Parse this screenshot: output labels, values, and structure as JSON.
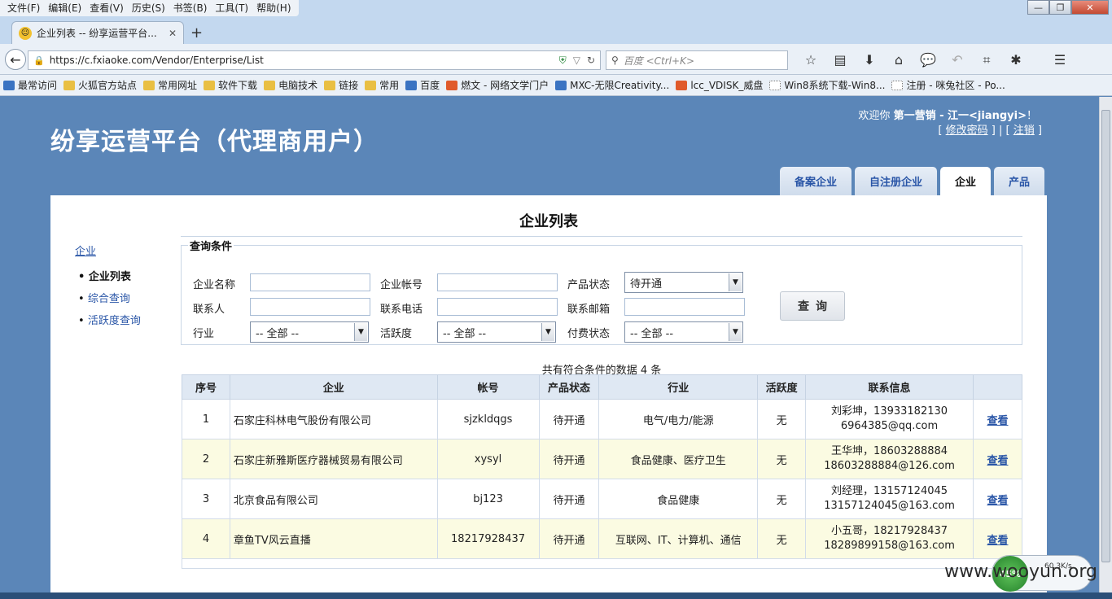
{
  "browser": {
    "menus": [
      "文件(F)",
      "编辑(E)",
      "查看(V)",
      "历史(S)",
      "书签(B)",
      "工具(T)",
      "帮助(H)"
    ],
    "tab_title": "企业列表 -- 纷享运营平台...",
    "url": "https://c.fxiaoke.com/Vendor/Enterprise/List",
    "search_placeholder": "百度 <Ctrl+K>",
    "bookmarks": [
      "最常访问",
      "火狐官方站点",
      "常用网址",
      "软件下载",
      "电脑技术",
      "链接",
      "常用",
      "百度",
      "燃文 - 网络文学门户",
      "MXC-无限Creativity...",
      "lcc_VDISK_威盘",
      "Win8系统下载-Win8...",
      "注册 - 咪兔社区 - Po..."
    ]
  },
  "header": {
    "site_title": "纷享运营平台（代理商用户）",
    "welcome_prefix": "欢迎你",
    "welcome_user": "第一营销 - 江一<jiangyi>",
    "welcome_suffix": "！",
    "change_password": "修改密码",
    "logout": "注销",
    "bracket_open": "[",
    "bracket_close": "]",
    "separator": "|"
  },
  "nav_tabs": [
    "备案企业",
    "自注册企业",
    "企业",
    "产品"
  ],
  "panel_title": "企业列表",
  "left_nav": {
    "header": "企业",
    "items": [
      "企业列表",
      "综合查询",
      "活跃度查询"
    ]
  },
  "query": {
    "legend": "查询条件",
    "labels": {
      "name": "企业名称",
      "account": "企业帐号",
      "product_status": "产品状态",
      "contact": "联系人",
      "phone": "联系电话",
      "email": "联系邮箱",
      "industry": "行业",
      "activity": "活跃度",
      "pay_status": "付费状态"
    },
    "values": {
      "name": "",
      "account": "",
      "contact": "",
      "phone": "",
      "email": "",
      "product_status": "待开通",
      "industry": "-- 全部 --",
      "activity": "-- 全部 --",
      "pay_status": "-- 全部 --"
    },
    "button": "查询"
  },
  "result_count": "共有符合条件的数据 4 条",
  "table": {
    "headers": [
      "序号",
      "企业",
      "帐号",
      "产品状态",
      "行业",
      "活跃度",
      "联系信息",
      ""
    ],
    "rows": [
      {
        "no": "1",
        "company": "石家庄科林电气股份有限公司",
        "account": "sjzkldqgs",
        "status": "待开通",
        "industry": "电气/电力/能源",
        "activity": "无",
        "contact1": "刘彩坤，13933182130",
        "contact2": "6964385@qq.com",
        "action": "查看"
      },
      {
        "no": "2",
        "company": "石家庄新雅斯医疗器械贸易有限公司",
        "account": "xysyl",
        "status": "待开通",
        "industry": "食品健康、医疗卫生",
        "activity": "无",
        "contact1": "王华坤，18603288884",
        "contact2": "18603288884@126.com",
        "action": "查看"
      },
      {
        "no": "3",
        "company": "北京食品有限公司",
        "account": "bj123",
        "status": "待开通",
        "industry": "食品健康",
        "activity": "无",
        "contact1": "刘经理，13157124045",
        "contact2": "13157124045@163.com",
        "action": "查看"
      },
      {
        "no": "4",
        "company": "章鱼TV风云直播",
        "account": "18217928437",
        "status": "待开通",
        "industry": "互联网、IT、计算机、通信",
        "activity": "无",
        "contact1": "小五哥，18217928437",
        "contact2": "18289899158@163.com",
        "action": "查看"
      }
    ]
  },
  "overlay": {
    "watermark": "www.wooyun.org",
    "speed_percent": "45%",
    "speed_rate": "60.3K/s"
  }
}
